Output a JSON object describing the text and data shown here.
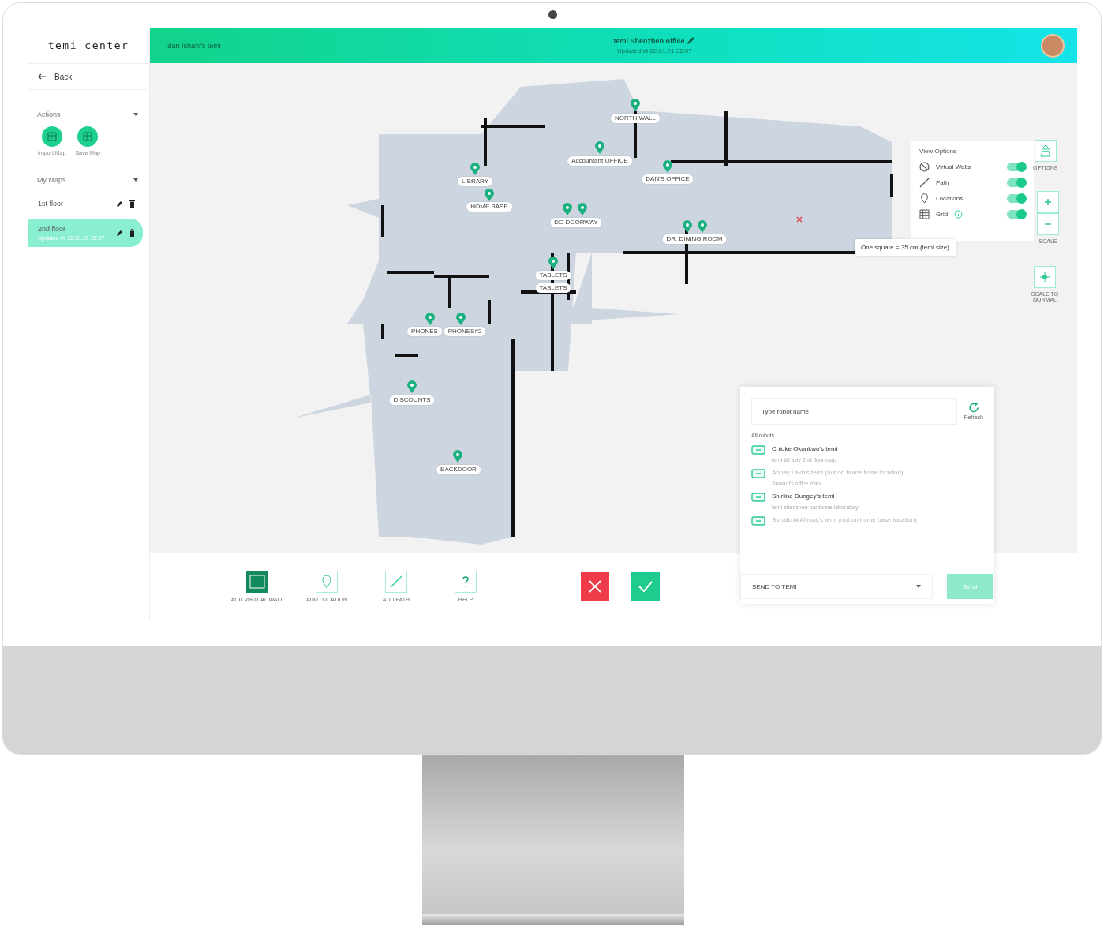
{
  "sidebar": {
    "logo": "temi center",
    "back": "Back",
    "actions": {
      "title": "Actions",
      "buttons": [
        {
          "label": "Import Map"
        },
        {
          "label": "Save Map"
        }
      ]
    },
    "maps": {
      "title": "My Maps",
      "items": [
        {
          "name": "1st floor",
          "selected": false
        },
        {
          "name": "2nd floor",
          "updated": "Updated in: 22.01.21 22:07",
          "selected": true
        }
      ]
    }
  },
  "top_bar": {
    "robot": "Idan Ishahi's temi",
    "map_title": "temi Shenzhen office",
    "updated": "Updated at 22.01.21 22:07"
  },
  "map": {
    "locations": [
      {
        "label": "NORTH WALL"
      },
      {
        "label": "Accountant OFFICE"
      },
      {
        "label": "DAN'S OFFICE"
      },
      {
        "label": "LIBRARY"
      },
      {
        "label": "HOME BASE"
      },
      {
        "label": "DO DOORWAY"
      },
      {
        "label": "DR. DINING ROOM"
      },
      {
        "label": "TABLETS"
      },
      {
        "label": "TABLETS"
      },
      {
        "label": "PHONES"
      },
      {
        "label": "PHONES#2"
      },
      {
        "label": "DISCOUNTS"
      },
      {
        "label": "BACKDOOR"
      }
    ],
    "view_options": {
      "title": "View Options",
      "items": [
        {
          "kind": "walls",
          "label": "Virtual Walls",
          "on": true
        },
        {
          "kind": "path",
          "label": "Path",
          "on": true
        },
        {
          "kind": "locations",
          "label": "Locations",
          "on": true
        },
        {
          "kind": "grid",
          "label": "Grid",
          "on": true
        }
      ]
    },
    "tooltip": "One square = 35 cm (temi size)",
    "options_button": "OPTIONS",
    "scale_label": "SCALE",
    "scale_normal": "SCALE TO NORMAL"
  },
  "toolbar": {
    "tools": [
      {
        "kind": "wall",
        "label": "ADD VIRTUAL WALL",
        "selected": true
      },
      {
        "kind": "location",
        "label": "ADD LOCATION",
        "selected": false
      },
      {
        "kind": "path",
        "label": "ADD PATH",
        "selected": false
      },
      {
        "kind": "help",
        "label": "HELP",
        "selected": false
      }
    ]
  },
  "robot_panel": {
    "placeholder": "Type robot name",
    "refresh": "Refresh",
    "group": "All robots",
    "robots": [
      {
        "name": "Chioke Okonkwo's temi",
        "location": "temi tel aviv 2nd floor map",
        "disabled": false
      },
      {
        "name": "Abhay Lakh's temi (not on home base location)",
        "location": "Suwadi's office map",
        "disabled": true
      },
      {
        "name": "Shirline Dungey's temi",
        "location": "temi shenzhen hardware laboratory",
        "disabled": false
      },
      {
        "name": "Suhaib Al Allmay's temi (not on home base location)",
        "disabled": true
      }
    ],
    "send_select": "SEND TO TEMI",
    "send_button": "Send"
  }
}
